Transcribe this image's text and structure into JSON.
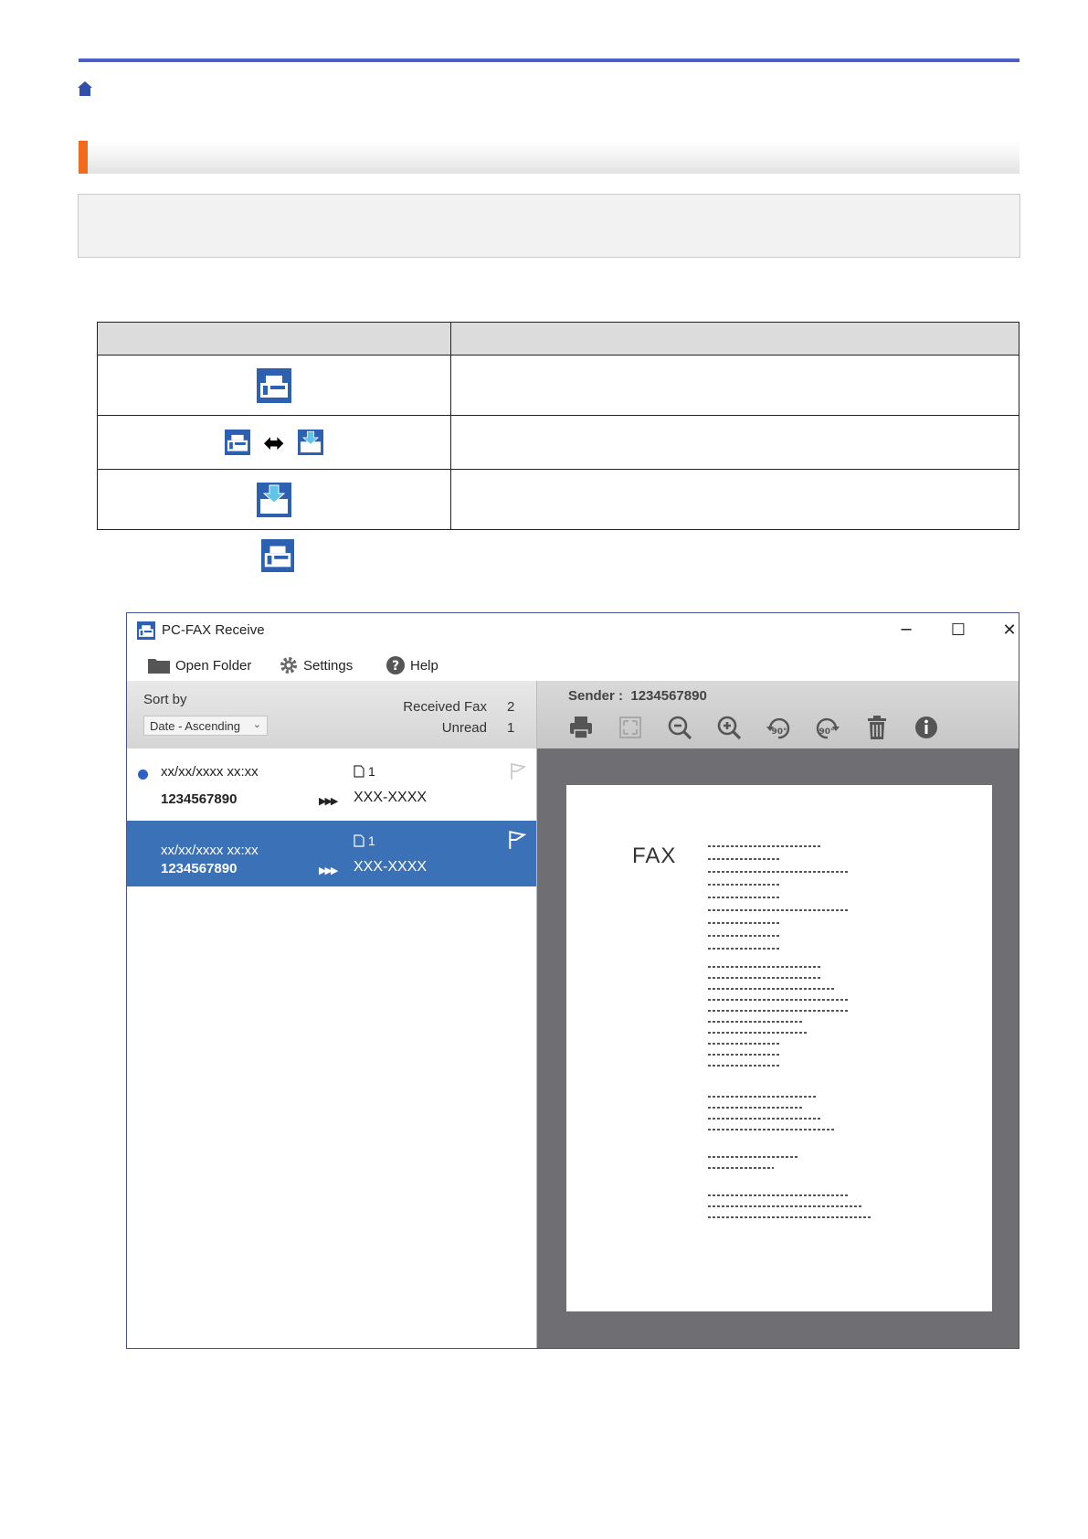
{
  "colors": {
    "rule": "#4b5fc7",
    "accent": "#f26b1d",
    "selected_row": "#3b71b7",
    "fax_icon": "#2d60b0"
  },
  "window": {
    "title": "PC-FAX Receive",
    "menu": {
      "open_folder": "Open Folder",
      "settings": "Settings",
      "help": "Help"
    },
    "left_header": {
      "sort_label": "Sort by",
      "sort_value": "Date - Ascending",
      "received_label": "Received Fax",
      "received_count": "2",
      "unread_label": "Unread",
      "unread_count": "1"
    },
    "rows": [
      {
        "date": "xx/xx/xxxx xx:xx",
        "pages": "1",
        "number": "1234567890",
        "dest": "XXX-XXXX",
        "unread": true
      },
      {
        "date": "xx/xx/xxxx xx:xx",
        "pages": "1",
        "number": "1234567890",
        "dest": "XXX-XXXX",
        "unread": false
      }
    ],
    "preview": {
      "sender_label": "Sender :",
      "sender_value": "1234567890",
      "fax_word": "FAX",
      "rotate_left": "90°",
      "rotate_right": "90°"
    },
    "icons": [
      "print-icon",
      "fit-icon",
      "zoom-out-icon",
      "zoom-in-icon",
      "rotate-left-icon",
      "rotate-right-icon",
      "trash-icon",
      "info-icon"
    ]
  }
}
